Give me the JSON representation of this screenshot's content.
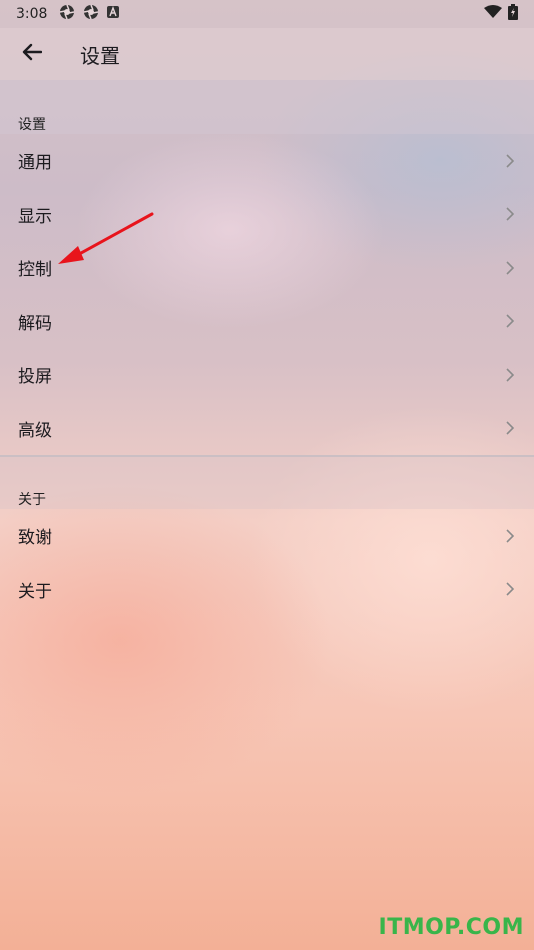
{
  "status_bar": {
    "time": "3:08",
    "icons_left": [
      "aperture-icon",
      "aperture-icon",
      "a-box-icon"
    ],
    "icons_right": [
      "wifi-icon",
      "battery-charging-icon"
    ]
  },
  "app_bar": {
    "back_icon": "arrow-back-icon",
    "title": "设置"
  },
  "sections": [
    {
      "header": "设置",
      "items": [
        {
          "label": "通用",
          "icon": "chevron-right-icon"
        },
        {
          "label": "显示",
          "icon": "chevron-right-icon"
        },
        {
          "label": "控制",
          "icon": "chevron-right-icon"
        },
        {
          "label": "解码",
          "icon": "chevron-right-icon"
        },
        {
          "label": "投屏",
          "icon": "chevron-right-icon"
        },
        {
          "label": "高级",
          "icon": "chevron-right-icon"
        }
      ]
    },
    {
      "header": "关于",
      "items": [
        {
          "label": "致谢",
          "icon": "chevron-right-icon"
        },
        {
          "label": "关于",
          "icon": "chevron-right-icon"
        }
      ]
    }
  ],
  "watermark": "ITMOP.COM",
  "colors": {
    "annotation_arrow": "#e8141c",
    "watermark": "#39b54a",
    "chevron": "#8a8a8a"
  }
}
